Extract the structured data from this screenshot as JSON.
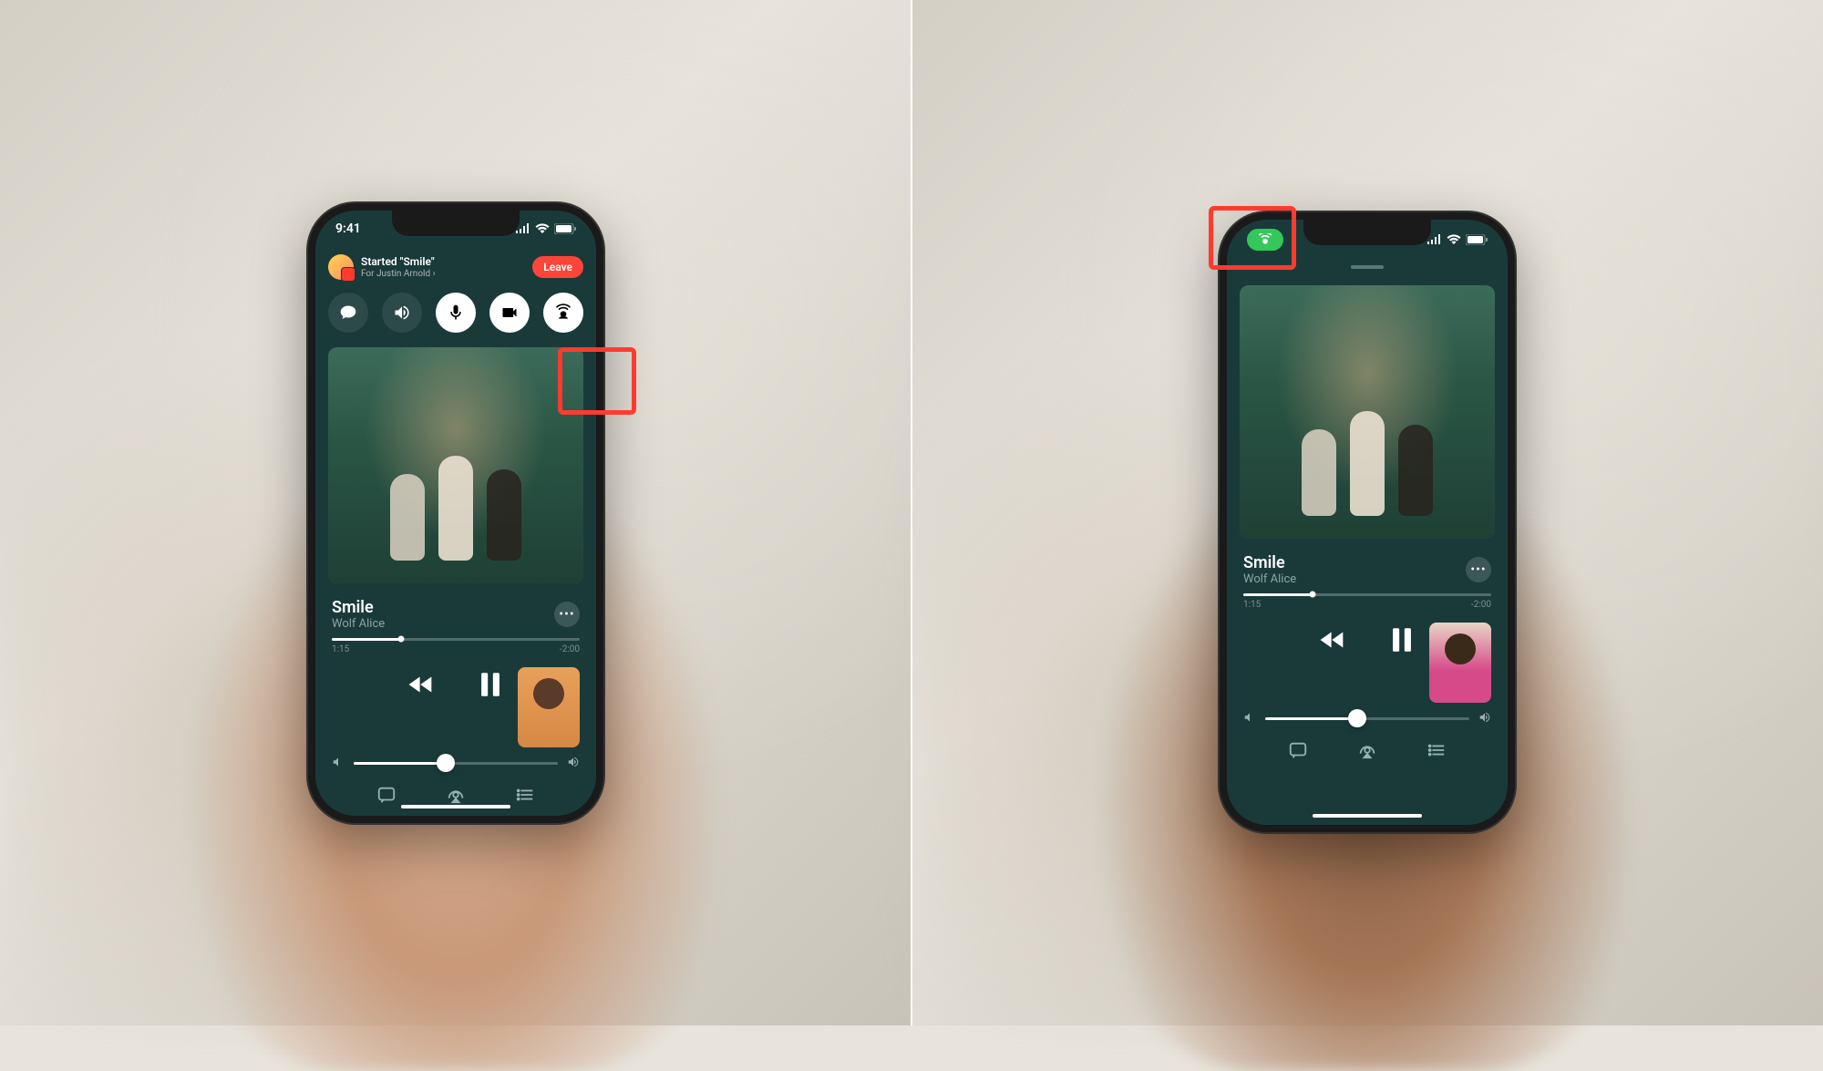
{
  "status": {
    "time": "9:41"
  },
  "call": {
    "title": "Started \"Smile\"",
    "subtitle": "For Justin Arnold ›",
    "leave_label": "Leave"
  },
  "track": {
    "title": "Smile",
    "artist": "Wolf Alice",
    "elapsed": "1:15",
    "remaining": "-2:00"
  },
  "icons": {
    "messages": "messages-icon",
    "speaker": "speaker-icon",
    "mic": "mic-icon",
    "camera": "camera-icon",
    "shareplay": "shareplay-icon",
    "more": "•••",
    "rewind": "rewind-icon",
    "pause": "pause-icon",
    "lyrics": "lyrics-icon",
    "airplay": "airplay-icon",
    "queue": "queue-icon"
  },
  "colors": {
    "highlight": "#ff3b30",
    "shareplay_pill": "#34c759",
    "leave": "#ff453a"
  }
}
